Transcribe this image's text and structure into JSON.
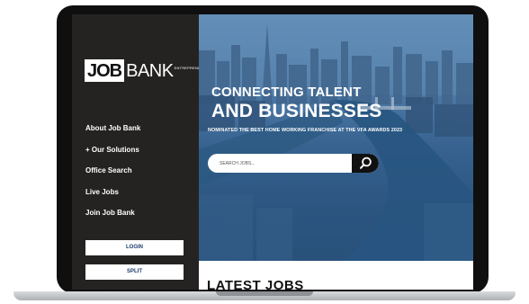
{
  "logo": {
    "part1": "JOB",
    "part2": "BANK",
    "tagline": "ENTREPRENEUR"
  },
  "nav": {
    "items": [
      {
        "label": "About Job Bank"
      },
      {
        "label": "+ Our Solutions"
      },
      {
        "label": "Office Search"
      },
      {
        "label": "Live Jobs"
      },
      {
        "label": "Join Job Bank"
      }
    ]
  },
  "buttons": {
    "login": "LOGIN",
    "split": "SPLIT"
  },
  "hero": {
    "title_line1": "CONNECTING TALENT",
    "title_line2": "AND BUSINESSES",
    "subtitle": "NOMINATED THE BEST HOME WORKING FRANCHISE AT THE VFA AWARDS 2023"
  },
  "search": {
    "placeholder": "SEARCH JOBS...",
    "icon": "search-icon"
  },
  "content": {
    "heading": "LATEST JOBS"
  },
  "colors": {
    "sidebar": "#242321",
    "button_text": "#1d3a6f",
    "search_button": "#111111"
  }
}
